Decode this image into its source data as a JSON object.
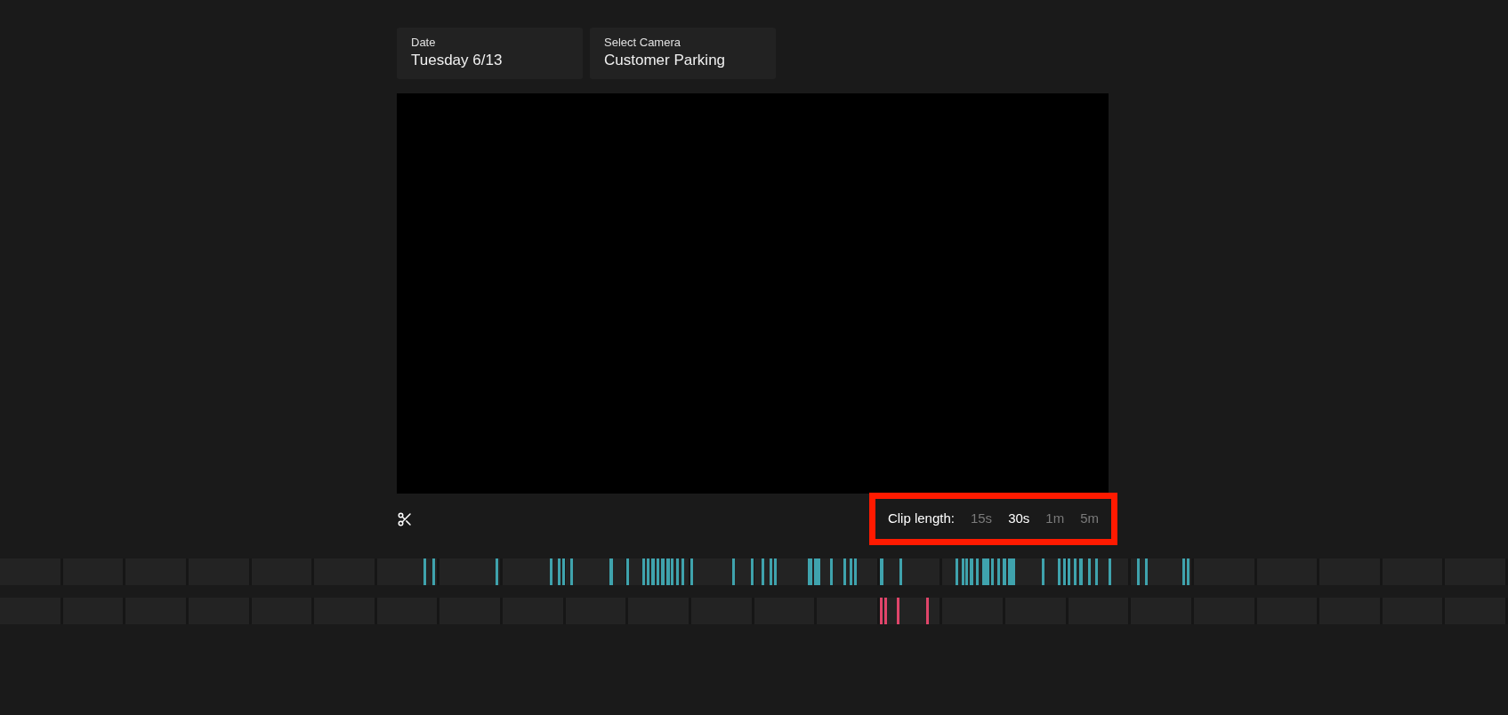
{
  "filters": [
    {
      "label": "Date",
      "value": "Tuesday 6/13"
    },
    {
      "label": "Select Camera",
      "value": "Customer Parking"
    }
  ],
  "video": {
    "kind": "blank"
  },
  "clip_length": {
    "label": "Clip length:",
    "highlighted": true,
    "options": [
      {
        "label": "15s",
        "selected": false
      },
      {
        "label": "30s",
        "selected": true
      },
      {
        "label": "1m",
        "selected": false
      },
      {
        "label": "5m",
        "selected": false
      }
    ]
  },
  "tracks": [
    {
      "color": "#3fa3ad"
    },
    {
      "color": "#e0456a"
    }
  ]
}
